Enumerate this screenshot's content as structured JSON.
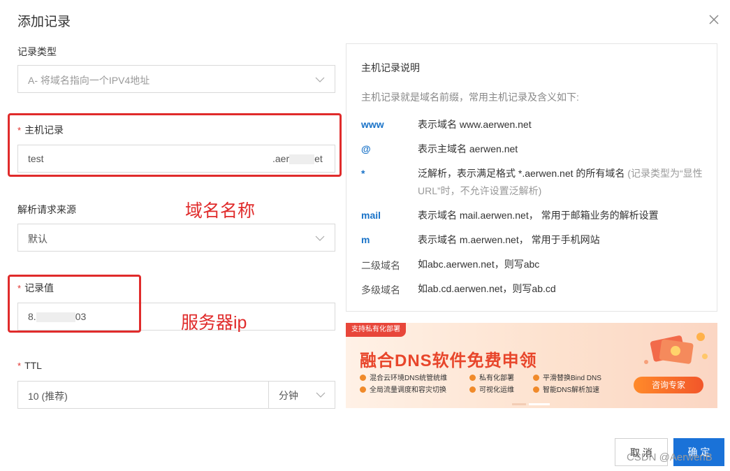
{
  "dialog": {
    "title": "添加记录"
  },
  "form": {
    "record_type": {
      "label": "记录类型",
      "value": "A- 将域名指向一个IPV4地址"
    },
    "host_record": {
      "required_mark": "*",
      "label": "主机记录",
      "value": "test",
      "suffix_prefix": ".aer",
      "suffix_end": "et"
    },
    "resolve_source": {
      "label": "解析请求来源",
      "value": "默认"
    },
    "record_value": {
      "required_mark": "*",
      "label": "记录值",
      "value_prefix": "8.",
      "value_end": "03"
    },
    "ttl": {
      "required_mark": "*",
      "label": "TTL",
      "value": "10 (推荐)",
      "unit": "分钟"
    }
  },
  "annotations": {
    "domain_name": "域名名称",
    "server_ip": "服务器ip",
    "color": "#e02b2b"
  },
  "help": {
    "title": "主机记录说明",
    "intro": "主机记录就是域名前缀，常用主机记录及含义如下:",
    "rows": [
      {
        "key": "www",
        "desc": "表示域名 www.aerwen.net"
      },
      {
        "key": "@",
        "desc": "表示主域名 aerwen.net"
      },
      {
        "key": "*",
        "desc": "泛解析，表示满足格式 *.aerwen.net 的所有域名",
        "note": "(记录类型为“显性URL”时，不允许设置泛解析)"
      },
      {
        "key": "mail",
        "desc": "表示域名 mail.aerwen.net， 常用于邮箱业务的解析设置"
      },
      {
        "key": "m",
        "desc": "表示域名 m.aerwen.net， 常用于手机网站"
      },
      {
        "key": "二级域名",
        "desc": "如abc.aerwen.net，则写abc"
      },
      {
        "key": "多级域名",
        "desc": "如ab.cd.aerwen.net，则写ab.cd"
      }
    ]
  },
  "banner": {
    "tag": "支持私有化部署",
    "headline": "融合DNS软件免费申领",
    "features": [
      "混合云环境DNS统管统维",
      "私有化部署",
      "平滑替换Bind DNS",
      "全局流量调度和容灾切换",
      "可视化运维",
      "智能DNS解析加速"
    ],
    "cta": "咨询专家"
  },
  "buttons": {
    "cancel": "取 消",
    "ok": "确 定"
  },
  "watermark": "CSDN @AerwenB",
  "colors": {
    "primary": "#1a72d8",
    "required": "#e0332f",
    "help_key": "#1a73c8"
  },
  "icons": {
    "close": "close-icon",
    "select": "chevron-down-icon"
  }
}
